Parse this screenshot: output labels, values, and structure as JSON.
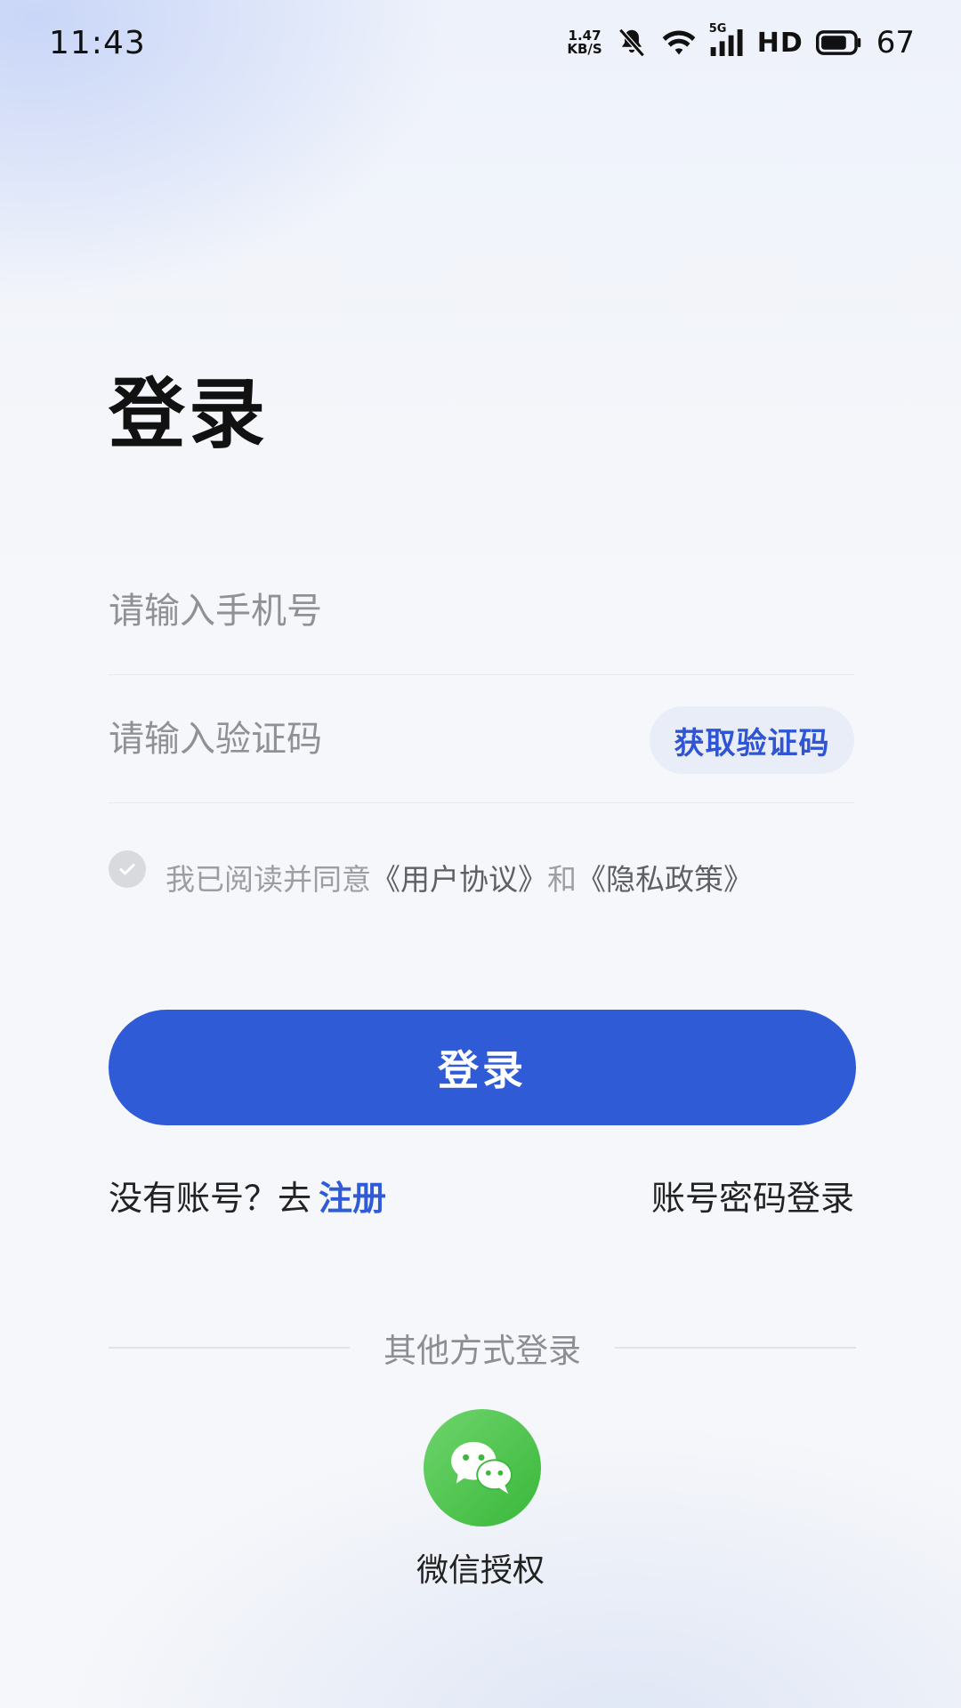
{
  "status_bar": {
    "time": "11:43",
    "net_speed_value": "1.47",
    "net_speed_unit": "KB/S",
    "network_type": "5G",
    "hd_label": "HD",
    "battery_level": "67"
  },
  "page": {
    "title": "登录"
  },
  "form": {
    "phone_placeholder": "请输入手机号",
    "code_placeholder": "请输入验证码",
    "get_code_label": "获取验证码"
  },
  "agreement": {
    "prefix": "我已阅读并同意",
    "user_agreement": "《用户协议》",
    "and": "和",
    "privacy_policy": "《隐私政策》",
    "checked": false
  },
  "login_button": {
    "label": "登录"
  },
  "register": {
    "prompt": "没有账号？去",
    "link": "注册"
  },
  "password_login": {
    "label": "账号密码登录"
  },
  "other_login": {
    "divider_label": "其他方式登录",
    "wechat_label": "微信授权"
  },
  "colors": {
    "primary": "#2f5bd6",
    "wechat_green": "#39b83a",
    "chip_bg": "#e9edf8"
  }
}
